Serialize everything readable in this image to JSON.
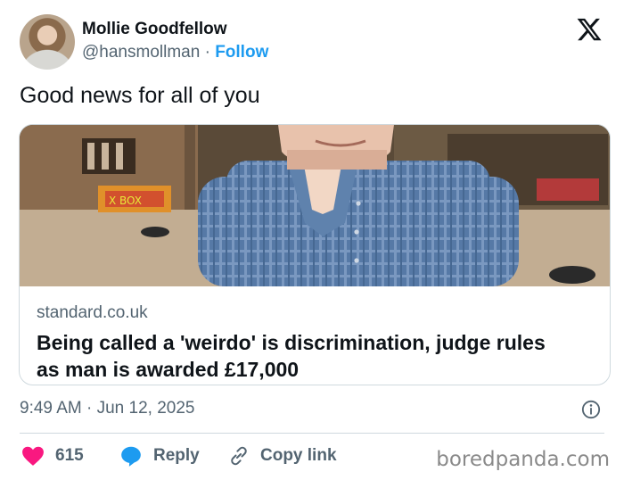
{
  "author": {
    "name": "Mollie Goodfellow",
    "handle": "@hansmollman",
    "separator": "·",
    "follow_label": "Follow"
  },
  "tweet": {
    "text": "Good news for all of you",
    "timestamp": "9:49 AM · Jun 12, 2025"
  },
  "card": {
    "domain": "standard.co.uk",
    "title": "Being called a 'weirdo' is discrimination, judge rules as man is awarded £17,000",
    "image_sign_text": "X BOX"
  },
  "actions": {
    "likes_count": "615",
    "reply_label": "Reply",
    "copy_link_label": "Copy link"
  },
  "watermark": "boredpanda.com",
  "colors": {
    "like": "#f91880",
    "reply": "#1d9bf0",
    "follow": "#1d9bf0",
    "secondary_text": "#536471"
  },
  "icons": [
    "x-logo-icon",
    "info-icon",
    "heart-icon",
    "reply-bubble-icon",
    "link-icon"
  ]
}
